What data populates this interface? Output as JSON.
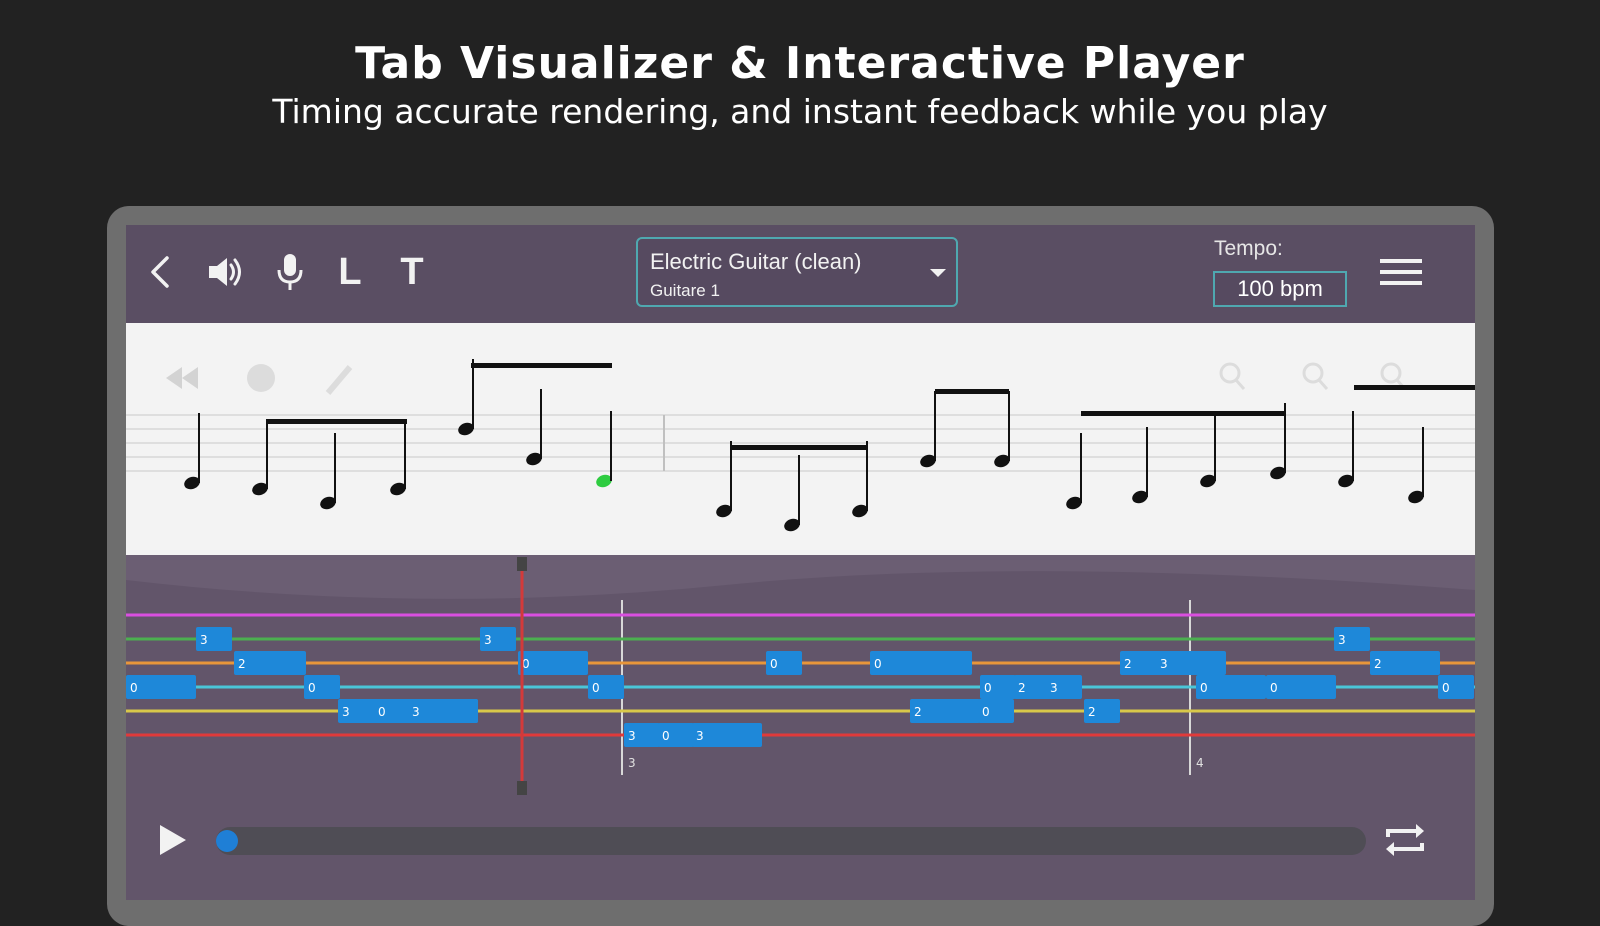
{
  "header": {
    "title": "Tab Visualizer & Interactive Player",
    "subtitle": "Timing accurate rendering, and instant feedback while you play"
  },
  "toolbar": {
    "icons": [
      "back-icon",
      "speaker-icon",
      "microphone-icon",
      "letter-l",
      "letter-t"
    ],
    "letter_l": "L",
    "letter_t": "T",
    "instrument_name": "Electric Guitar (clean)",
    "track_name": "Guitare 1",
    "tempo_label": "Tempo:",
    "tempo_value": "100 bpm",
    "accent_color": "#4fa8b0"
  },
  "notation_tools": [
    "rewind-icon",
    "palette-icon",
    "pencil-icon",
    "zoom-in-icon",
    "zoom-out-icon",
    "search-icon"
  ],
  "tab": {
    "string_colors": [
      "#d94fe0",
      "#4caf50",
      "#e8963a",
      "#4ac6d8",
      "#d8c84a",
      "#e03a3a"
    ],
    "note_color": "#1e88d9",
    "playhead_color": "#d33a3a",
    "measure_numbers": [
      "3",
      "4"
    ],
    "notes": [
      {
        "s": 1,
        "f": "3"
      },
      {
        "s": 2,
        "f": "2"
      },
      {
        "s": 3,
        "f": "0"
      },
      {
        "s": 3,
        "f": "0"
      },
      {
        "s": 4,
        "f": "3"
      },
      {
        "s": 4,
        "f": "0"
      },
      {
        "s": 4,
        "f": "3"
      },
      {
        "s": 1,
        "f": "3"
      },
      {
        "s": 2,
        "f": "0"
      },
      {
        "s": 3,
        "f": "0"
      },
      {
        "s": 5,
        "f": "3"
      },
      {
        "s": 5,
        "f": "0"
      },
      {
        "s": 5,
        "f": "3"
      },
      {
        "s": 2,
        "f": "0"
      },
      {
        "s": 2,
        "f": "0"
      },
      {
        "s": 4,
        "f": "0"
      },
      {
        "s": 4,
        "f": "2"
      },
      {
        "s": 3,
        "f": "0"
      },
      {
        "s": 3,
        "f": "2"
      },
      {
        "s": 3,
        "f": "3"
      },
      {
        "s": 4,
        "f": "2"
      },
      {
        "s": 2,
        "f": "2"
      },
      {
        "s": 2,
        "f": "3"
      },
      {
        "s": 3,
        "f": "0"
      },
      {
        "s": 3,
        "f": "0"
      },
      {
        "s": 1,
        "f": "3"
      },
      {
        "s": 2,
        "f": "2"
      },
      {
        "s": 3,
        "f": "0"
      }
    ]
  },
  "transport": {
    "icons": [
      "play-icon",
      "repeat-icon"
    ]
  }
}
